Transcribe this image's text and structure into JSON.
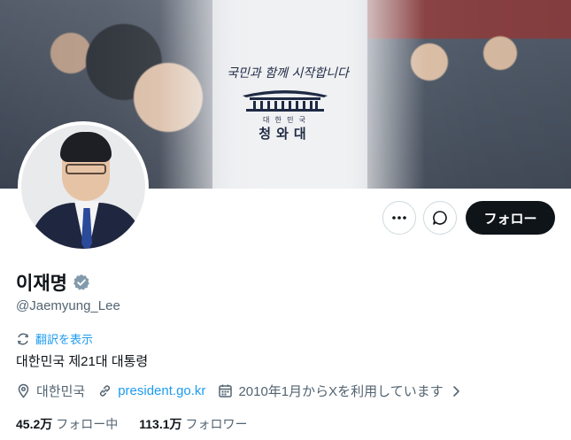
{
  "banner": {
    "slogan": "국민과 함께 시작합니다",
    "emblem_small": "대 한 민 국",
    "emblem_name": "청와대"
  },
  "actions": {
    "more_icon": "more-horizontal-icon",
    "message_icon": "message-icon",
    "follow_label": "フォロー"
  },
  "profile": {
    "display_name": "이재명",
    "verified_icon": "verified-badge-icon",
    "verified_color": "#829aab",
    "handle": "@Jaemyung_Lee",
    "translate_label": "翻訳を表示",
    "bio": "대한민국 제21대 대통령",
    "location": "대한민국",
    "website": "president.go.kr",
    "joined": "2010年1月からXを利用しています"
  },
  "stats": {
    "following_count": "45.2万",
    "following_label": "フォロー中",
    "followers_count": "113.1万",
    "followers_label": "フォロワー"
  },
  "colors": {
    "link": "#1d9bf0",
    "secondary_text": "#536471",
    "primary_text": "#0f1419",
    "follow_button_bg": "#0f1419"
  }
}
